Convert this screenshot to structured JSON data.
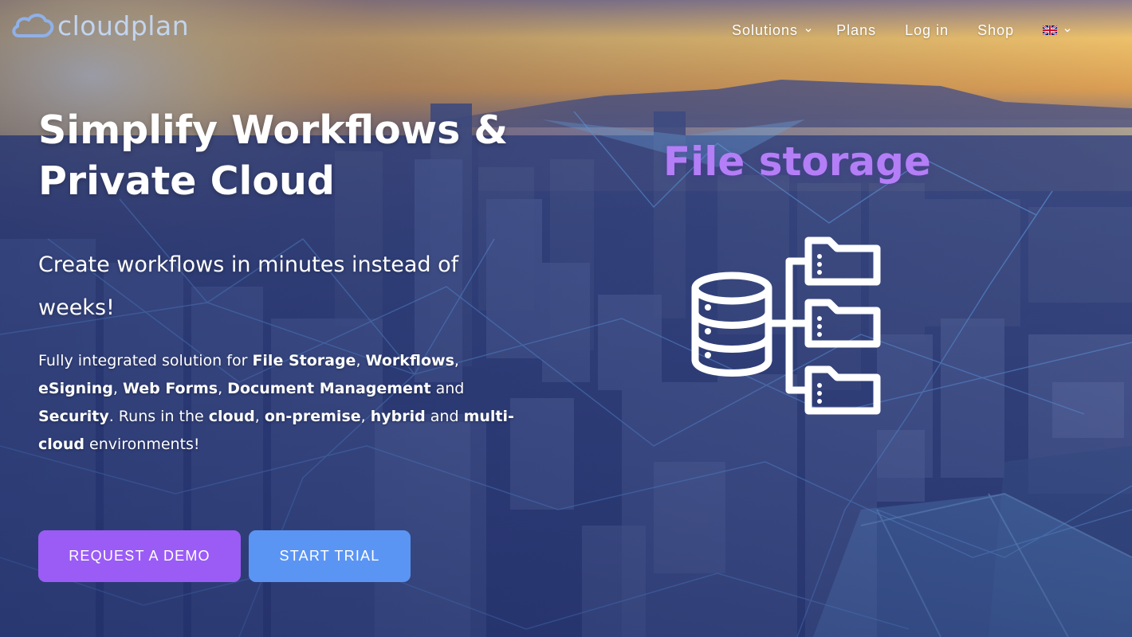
{
  "header": {
    "logo_text": "cloudplan",
    "nav": {
      "solutions": "Solutions",
      "plans": "Plans",
      "login": "Log in",
      "shop": "Shop",
      "language_icon": "uk-flag-icon"
    }
  },
  "hero": {
    "title": "Simplify Workflows & Private Cloud",
    "subtitle": "Create workflows in minutes instead of weeks!",
    "description": {
      "t1": "Fully integrated solution for ",
      "b1": "File Storage",
      "t2": ", ",
      "b2": "Workflows",
      "t3": ", ",
      "b3": "eSigning",
      "t4": ", ",
      "b4": "Web Forms",
      "t5": ", ",
      "b5": "Document Management",
      "t6": " and ",
      "b6": "Security",
      "t7": ". Runs in the ",
      "b7": "cloud",
      "t8": ", ",
      "b8": "on-premise",
      "t9": ", ",
      "b9": "hybrid",
      "t10": " and ",
      "b10": "multi-cloud",
      "t11": " environments!"
    },
    "buttons": {
      "demo": "REQUEST A DEMO",
      "trial": "START TRIAL"
    }
  },
  "feature": {
    "title": "File storage",
    "icon": "database-folders-icon"
  },
  "colors": {
    "demo_button": "#9a5cf5",
    "trial_button": "#5b95f4",
    "feature_title": "#b47ef7",
    "text": "#ffffff"
  }
}
